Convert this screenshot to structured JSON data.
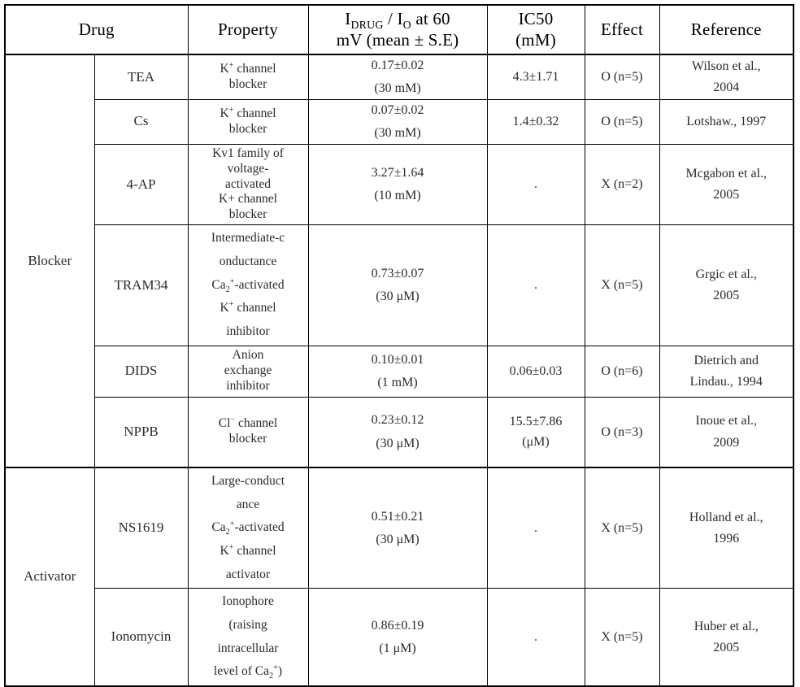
{
  "table": {
    "headers": {
      "drug": "Drug",
      "property": "Property",
      "ratio_line1_pre": "I",
      "ratio_line1_sub1": "DRUG",
      "ratio_line1_mid": " / I",
      "ratio_line1_sub2": "O",
      "ratio_line1_post": " at 60",
      "ratio_line2": "mV (mean ± S.E)",
      "ic50_line1": "IC50",
      "ic50_line2": "(mM)",
      "effect": "Effect",
      "reference": "Reference"
    },
    "sections": [
      {
        "label": "Blocker"
      },
      {
        "label": "Activator"
      }
    ],
    "rows": [
      {
        "section": "Blocker",
        "drug": "TEA",
        "property_html": "K<sup>+</sup> channel<br>blocker",
        "ratio_value": "0.17±0.02",
        "ratio_conc": "(30 mM)",
        "ic50": "4.3±1.71",
        "ic50_unit": "",
        "effect": "O (n=5)",
        "ref_line1": "Wilson et al.,",
        "ref_line2": "2004"
      },
      {
        "section": "Blocker",
        "drug": "Cs",
        "property_html": "K<sup>+</sup> channel<br>blocker",
        "ratio_value": "0.07±0.02",
        "ratio_conc": "(30 mM)",
        "ic50": "1.4±0.32",
        "ic50_unit": "",
        "effect": "O (n=5)",
        "ref_line1": "Lotshaw., 1997",
        "ref_line2": ""
      },
      {
        "section": "Blocker",
        "drug": "4-AP",
        "property_html": "Kv1 family of<br>voltage-<br>activated<br>K+ channel<br>blocker",
        "ratio_value": "3.27±1.64",
        "ratio_conc": "(10 mM)",
        "ic50": ".",
        "ic50_unit": "",
        "effect": "X (n=2)",
        "ref_line1": "Mcgabon et al.,",
        "ref_line2": "2005"
      },
      {
        "section": "Blocker",
        "drug": "TRAM34",
        "property_html": "Intermediate-c<br>onductance<br>Ca<sub>2</sub><sup>+</sup>-activated<br>K<sup>+</sup> channel<br>inhibitor",
        "ratio_value": "0.73±0.07",
        "ratio_conc": "(30 μM)",
        "ic50": ".",
        "ic50_unit": "",
        "effect": "X (n=5)",
        "ref_line1": "Grgic et al.,",
        "ref_line2": "2005"
      },
      {
        "section": "Blocker",
        "drug": "DIDS",
        "property_html": "Anion<br>exchange<br>inhibitor",
        "ratio_value": "0.10±0.01",
        "ratio_conc": "(1 mM)",
        "ic50": "0.06±0.03",
        "ic50_unit": "",
        "effect": "O (n=6)",
        "ref_line1": "Dietrich and",
        "ref_line2": "Lindau., 1994"
      },
      {
        "section": "Blocker",
        "drug": "NPPB",
        "property_html": "Cl<sup>−</sup> channel<br>blocker",
        "ratio_value": "0.23±0.12",
        "ratio_conc": "(30 μM)",
        "ic50": "15.5±7.86",
        "ic50_unit": "(μM)",
        "effect": "O (n=3)",
        "ref_line1": "Inoue et al.,",
        "ref_line2": "2009"
      },
      {
        "section": "Activator",
        "drug": "NS1619",
        "property_html": "Large-conduct<br>ance<br>Ca<sub>2</sub><sup>+</sup>-activated<br>K<sup>+</sup> channel<br>activator",
        "ratio_value": "0.51±0.21",
        "ratio_conc": "(30 μM)",
        "ic50": ".",
        "ic50_unit": "",
        "effect": "X (n=5)",
        "ref_line1": "Holland et al.,",
        "ref_line2": "1996"
      },
      {
        "section": "Activator",
        "drug": "Ionomycin",
        "property_html": "Ionophore<br>(raising<br>intracellular<br>level of Ca<sub>2</sub><sup>+</sup>)",
        "ratio_value": "0.86±0.19",
        "ratio_conc": "(1 μM)",
        "ic50": ".",
        "ic50_unit": "",
        "effect": "X (n=5)",
        "ref_line1": "Huber et al.,",
        "ref_line2": "2005"
      }
    ]
  }
}
